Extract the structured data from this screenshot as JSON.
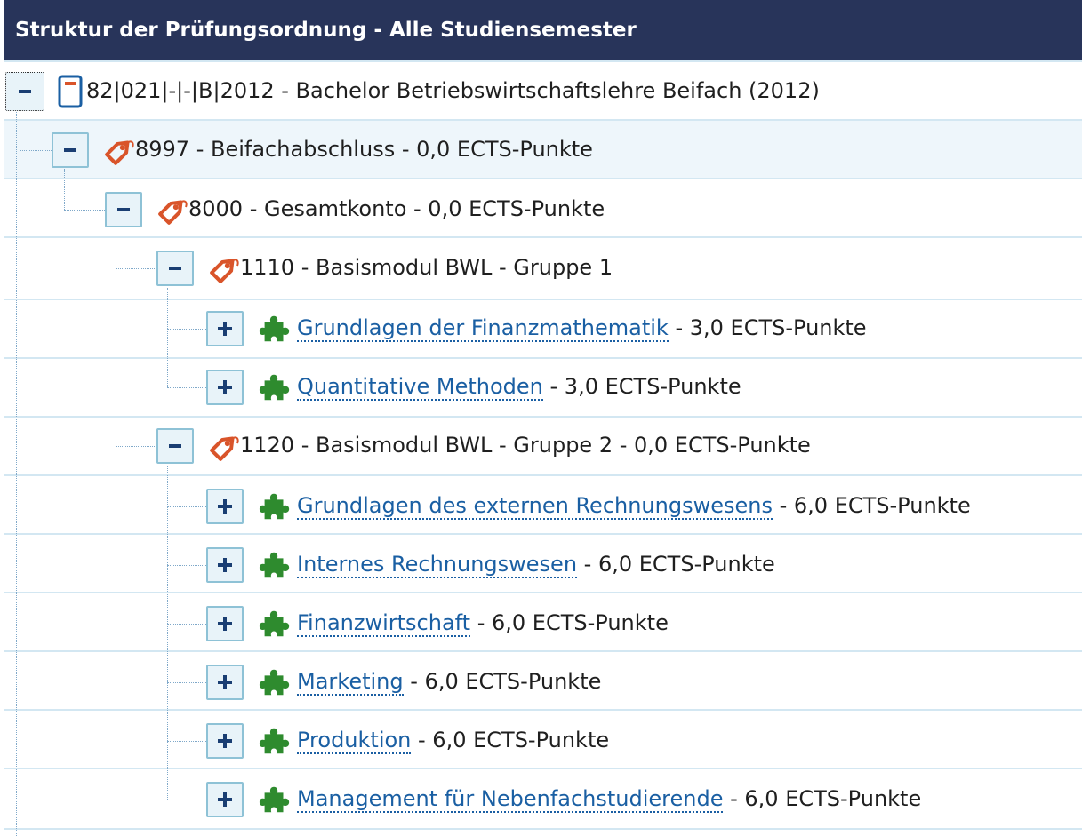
{
  "header": {
    "title": "Struktur der Prüfungsordnung - Alle Studiensemester"
  },
  "tree": {
    "root": {
      "label": "82|021|-|-|B|2012 - Bachelor Betriebswirtschaftslehre Beifach (2012)"
    },
    "n8997": {
      "label": "8997 - Beifachabschluss - 0,0 ECTS-Punkte"
    },
    "n8000": {
      "label": "8000 - Gesamtkonto - 0,0 ECTS-Punkte"
    },
    "n1110": {
      "label": "1110 - Basismodul BWL - Gruppe 1"
    },
    "m1": {
      "link": "Grundlagen der Finanzmathematik",
      "suffix": " - 3,0 ECTS-Punkte"
    },
    "m2": {
      "link": "Quantitative Methoden",
      "suffix": " - 3,0 ECTS-Punkte"
    },
    "n1120": {
      "label": "1120 - Basismodul BWL - Gruppe 2 - 0,0 ECTS-Punkte"
    },
    "m3": {
      "link": "Grundlagen des externen Rechnungswesens",
      "suffix": " - 6,0 ECTS-Punkte"
    },
    "m4": {
      "link": "Internes Rechnungswesen",
      "suffix": " - 6,0 ECTS-Punkte"
    },
    "m5": {
      "link": "Finanzwirtschaft",
      "suffix": " - 6,0 ECTS-Punkte"
    },
    "m6": {
      "link": "Marketing",
      "suffix": " - 6,0 ECTS-Punkte"
    },
    "m7": {
      "link": "Produktion",
      "suffix": " - 6,0 ECTS-Punkte"
    },
    "m8": {
      "link": "Management für Nebenfachstudierende",
      "suffix": " - 6,0 ECTS-Punkte"
    }
  },
  "icons": {
    "node_collapse": "minus-icon",
    "node_expand": "plus-icon",
    "degree": "degree-document-icon",
    "account": "tag-icon",
    "module": "puzzle-piece-icon"
  },
  "colors": {
    "header_bg": "#28345a",
    "link": "#1a5fa3",
    "tag": "#d9542a",
    "module": "#2e8b2e",
    "toggle_border": "#8ec2d6"
  }
}
